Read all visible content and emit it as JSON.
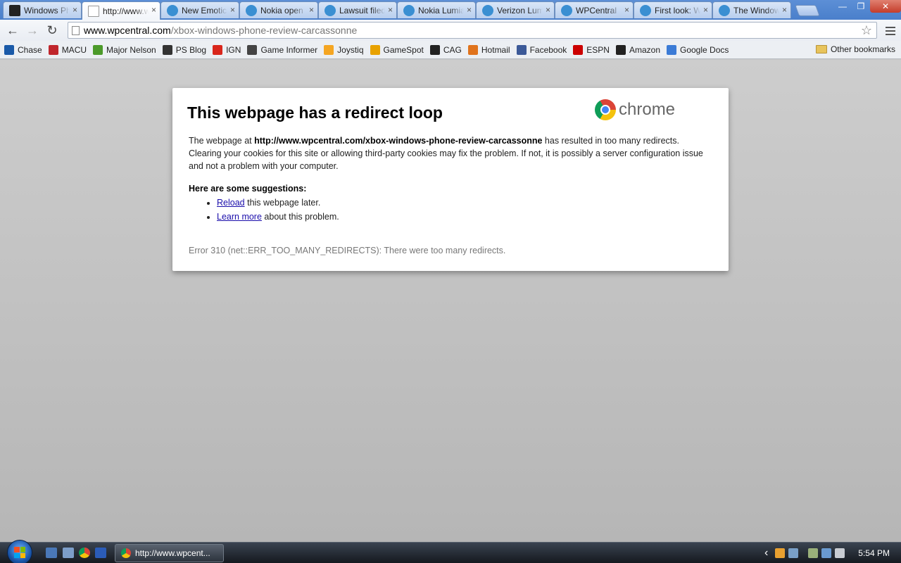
{
  "tabs": [
    {
      "title": "Windows Phone",
      "favicon": "cag",
      "active": false
    },
    {
      "title": "http://www.wpcentral.com",
      "favicon": "page",
      "active": true
    },
    {
      "title": "New Emoticons",
      "favicon": "wp",
      "active": false
    },
    {
      "title": "Nokia open",
      "favicon": "wp",
      "active": false
    },
    {
      "title": "Lawsuit filed",
      "favicon": "wp",
      "active": false
    },
    {
      "title": "Nokia Lumia",
      "favicon": "wp",
      "active": false
    },
    {
      "title": "Verizon Lumia",
      "favicon": "wp",
      "active": false
    },
    {
      "title": "WPCentral",
      "favicon": "wp",
      "active": false
    },
    {
      "title": "First look: W",
      "favicon": "wp",
      "active": false
    },
    {
      "title": "The Windows",
      "favicon": "wp",
      "active": false
    }
  ],
  "tab_close_glyph": "×",
  "window_controls": {
    "minimize": "—",
    "maximize": "❐",
    "close": "✕"
  },
  "toolbar": {
    "back": "←",
    "forward": "→",
    "reload": "↻",
    "url_host": "www.wpcentral.com",
    "url_path": "/xbox-windows-phone-review-carcassonne",
    "star": "☆"
  },
  "bookmarks": [
    {
      "label": "Chase",
      "icon": "chase-icon",
      "color": "#1a5aa8"
    },
    {
      "label": "MACU",
      "icon": "macu-icon",
      "color": "#c0262c"
    },
    {
      "label": "Major Nelson",
      "icon": "major-nelson-icon",
      "color": "#4c9a2a"
    },
    {
      "label": "PS Blog",
      "icon": "ps-blog-icon",
      "color": "#333333"
    },
    {
      "label": "IGN",
      "icon": "ign-icon",
      "color": "#d9261c"
    },
    {
      "label": "Game Informer",
      "icon": "game-informer-icon",
      "color": "#444444"
    },
    {
      "label": "Joystiq",
      "icon": "joystiq-icon",
      "color": "#f5a623"
    },
    {
      "label": "GameSpot",
      "icon": "gamespot-icon",
      "color": "#e8a200"
    },
    {
      "label": "CAG",
      "icon": "cag-icon",
      "color": "#222222"
    },
    {
      "label": "Hotmail",
      "icon": "hotmail-icon",
      "color": "#e0731c"
    },
    {
      "label": "Facebook",
      "icon": "facebook-icon",
      "color": "#3b5998"
    },
    {
      "label": "ESPN",
      "icon": "espn-icon",
      "color": "#cc0000"
    },
    {
      "label": "Amazon",
      "icon": "amazon-icon",
      "color": "#222222"
    },
    {
      "label": "Google Docs",
      "icon": "google-docs-icon",
      "color": "#3b7bd6"
    }
  ],
  "other_bookmarks": "Other bookmarks",
  "error": {
    "title": "This webpage has a redirect loop",
    "brand": "chrome",
    "text_before": "The webpage at ",
    "url": "http://www.wpcentral.com/xbox-windows-phone-review-carcassonne",
    "text_after": " has resulted in too many redirects. Clearing your cookies for this site or allowing third-party cookies may fix the problem. If not, it is possibly a server configuration issue and not a problem with your computer.",
    "suggestions_heading": "Here are some suggestions:",
    "suggestion1_link": "Reload",
    "suggestion1_rest": " this webpage later.",
    "suggestion2_link": "Learn more",
    "suggestion2_rest": " about this problem.",
    "code": "Error 310 (net::ERR_TOO_MANY_REDIRECTS): There were too many redirects."
  },
  "taskbar": {
    "window_title": "http://www.wpcent...",
    "clock": "5:54 PM",
    "tray_arrow": "‹"
  }
}
